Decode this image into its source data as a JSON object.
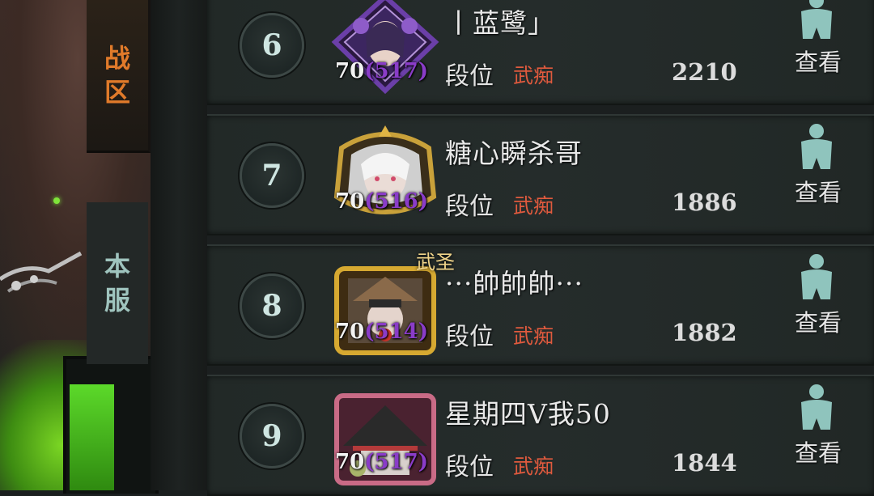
{
  "tabs": {
    "zone": "战区",
    "server": "本服"
  },
  "rows": [
    {
      "rank": "6",
      "level": "70",
      "power": "(517)",
      "name": "丨蓝鹭」",
      "duanwei_label": "段位",
      "duanwei": "武痴",
      "score": "2210",
      "view": "查看",
      "frame_color": "#6b3fa8"
    },
    {
      "rank": "7",
      "level": "70",
      "power": "(516)",
      "name": "糖心瞬杀哥",
      "duanwei_label": "段位",
      "duanwei": "武痴",
      "score": "1886",
      "view": "查看",
      "frame_color": "#c9a13a"
    },
    {
      "rank": "8",
      "level": "70",
      "power": "(514)",
      "name": "···帥帥帥···",
      "duanwei_label": "段位",
      "duanwei": "武痴",
      "score": "1882",
      "view": "查看",
      "frame_color": "#d6a931"
    },
    {
      "rank": "9",
      "level": "70",
      "power": "(517)",
      "name": "星期四V我50",
      "duanwei_label": "段位",
      "duanwei": "武痴",
      "score": "1844",
      "view": "查看",
      "frame_color": "#c96b86"
    }
  ],
  "colors": {
    "tab_active": "#e07a2a",
    "tab_inactive": "#9fc4be",
    "duanwei": "#e05a3e",
    "power": "#8a3cc8",
    "view_icon": "#8fc4bd"
  },
  "badge_text": "武圣"
}
